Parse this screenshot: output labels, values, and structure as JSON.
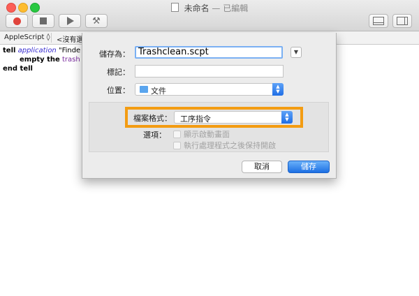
{
  "window": {
    "title": "未命名",
    "title_separator": "—",
    "status": "已編輯"
  },
  "toolbar": {
    "record_icon": "record-icon",
    "stop_icon": "stop-icon",
    "run_icon": "play-icon",
    "compile_icon": "hammer-icon",
    "view_icons": [
      "bottom-panel-icon",
      "side-panel-icon"
    ]
  },
  "navbar": {
    "language": "AppleScript ◊",
    "handler": "<沒有選"
  },
  "editor": {
    "line1": {
      "kw": "tell",
      "cls": "application",
      "str": "\"Finde"
    },
    "line2": {
      "kw": "empty the",
      "prop": "trash"
    },
    "line3": {
      "kw": "end tell"
    }
  },
  "dialog": {
    "save_as_label": "儲存為：",
    "file_name": "Trashclean.scpt",
    "tags_label": "標記：",
    "tags_value": "",
    "location_label": "位置：",
    "location_value": "文件",
    "format_label": "檔案格式：",
    "format_value": "工序指令",
    "options_label": "選項：",
    "option1": "顯示啟動畫面",
    "option2": "執行處理程式之後保持開啟",
    "cancel_label": "取消",
    "save_label": "儲存"
  },
  "colors": {
    "highlight": "#f39c12",
    "accent": "#1d6fe3"
  }
}
